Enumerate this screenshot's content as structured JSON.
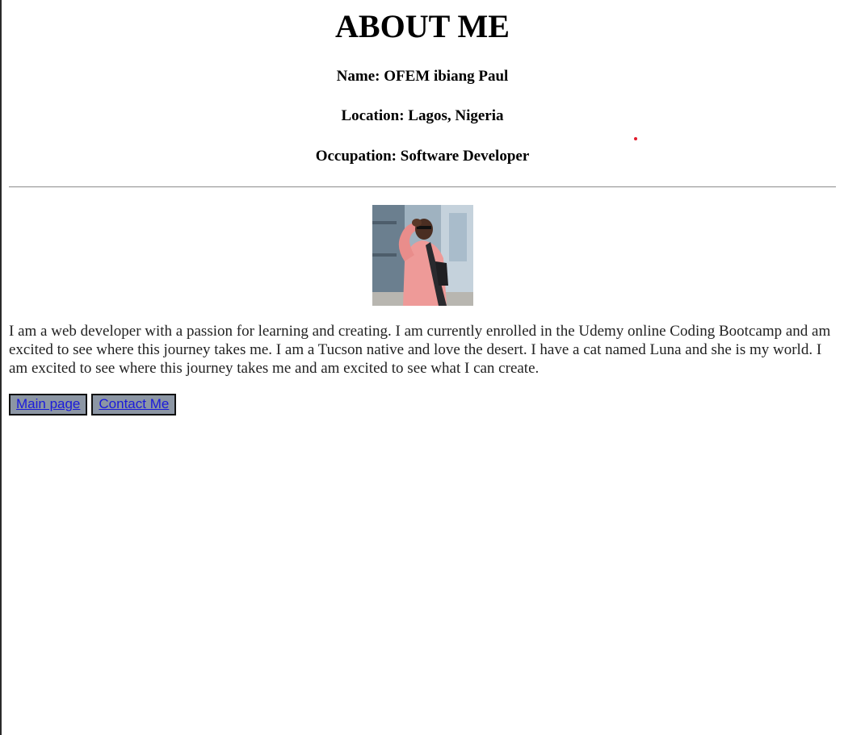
{
  "page": {
    "title": "ABOUT ME"
  },
  "info": {
    "name": "Name: OFEM ibiang Paul",
    "location": "Location: Lagos, Nigeria",
    "occupation": "Occupation: Software Developer"
  },
  "profile_photo": {
    "alt": "profile photo"
  },
  "bio": {
    "text": "I am a web developer with a passion for learning and creating. I am currently enrolled in the Udemy online Coding Bootcamp and am excited to see where this journey takes me. I am a Tucson native and love the desert. I have a cat named Luna and she is my world. I am excited to see where this journey takes me and am excited to see what I can create."
  },
  "nav": {
    "main_page": "Main page",
    "contact_me": "Contact Me"
  },
  "colors": {
    "button_bg": "#8c96a4",
    "link": "#1a1adc",
    "red_dot": "#e21b2c"
  }
}
